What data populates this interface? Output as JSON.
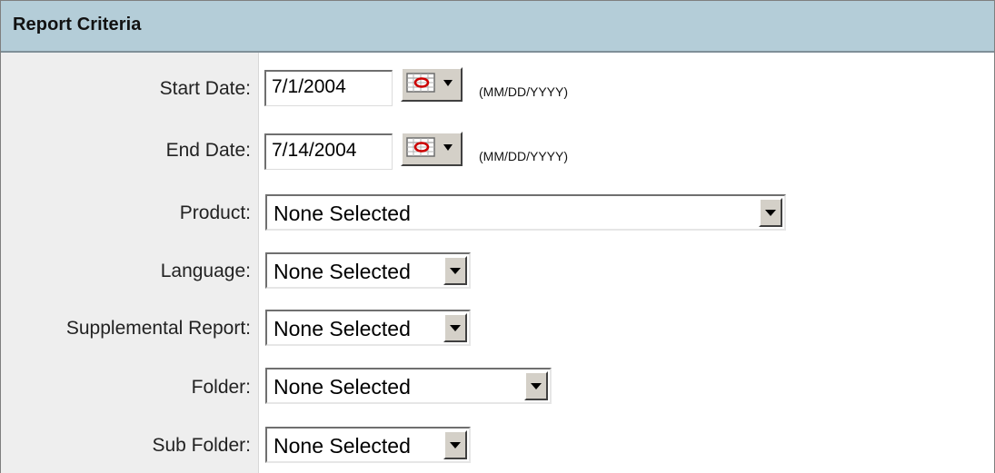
{
  "header": {
    "title": "Report Criteria"
  },
  "fields": {
    "start_date": {
      "label": "Start Date:",
      "value": "7/1/2004",
      "hint": "(MM/DD/YYYY)",
      "button_icon": "calendar-icon"
    },
    "end_date": {
      "label": "End Date:",
      "value": "7/14/2004",
      "hint": "(MM/DD/YYYY)",
      "button_icon": "calendar-icon"
    },
    "product": {
      "label": "Product:",
      "selected": "None Selected"
    },
    "language": {
      "label": "Language:",
      "selected": "None Selected"
    },
    "supplemental_report": {
      "label": "Supplemental Report:",
      "selected": "None Selected"
    },
    "folder": {
      "label": "Folder:",
      "selected": "None Selected"
    },
    "sub_folder": {
      "label": "Sub Folder:",
      "selected": "None Selected"
    }
  },
  "colors": {
    "header_bg": "#b4cdd8",
    "label_column_bg": "#eeeeee",
    "button_face": "#d4d0c8",
    "calendar_red": "#cc0000"
  }
}
